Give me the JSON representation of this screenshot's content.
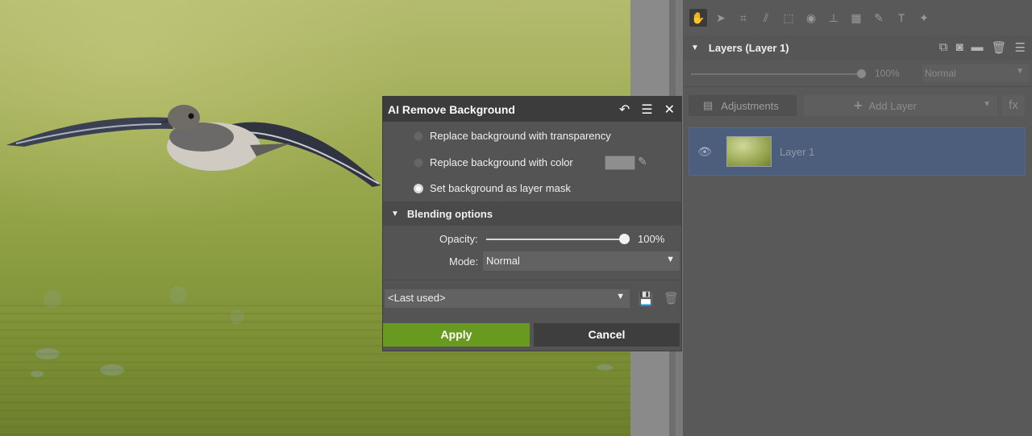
{
  "toolbar": {
    "tools": [
      "hand-icon",
      "pointer-icon",
      "crop-icon",
      "perspective-icon",
      "transform-icon",
      "redeye-icon",
      "stamp-icon",
      "grid-icon",
      "brush-icon",
      "text-icon",
      "effects-icon"
    ]
  },
  "layers_panel": {
    "title": "Layers (Layer 1)",
    "opacity": "100%",
    "opacity_value": 1.0,
    "mode": "Normal",
    "adjustments_label": "Adjustments",
    "add_layer_label": "Add Layer",
    "fx_label": "fx",
    "layers": [
      {
        "name": "Layer 1"
      }
    ]
  },
  "dialog": {
    "title": "AI Remove Background",
    "options": [
      {
        "label": "Replace background with transparency",
        "selected": false
      },
      {
        "label": "Replace background with color",
        "selected": false
      },
      {
        "label": "Set background as layer mask",
        "selected": true
      }
    ],
    "blending_title": "Blending options",
    "opacity_label": "Opacity:",
    "opacity_value": "100%",
    "opacity_fraction": 1.0,
    "mode_label": "Mode:",
    "mode_value": "Normal",
    "preset_value": "<Last used>",
    "apply_label": "Apply",
    "cancel_label": "Cancel"
  },
  "colors": {
    "apply": "#679a1e",
    "selected_layer": "#4d5e7d",
    "panel": "#595959"
  }
}
